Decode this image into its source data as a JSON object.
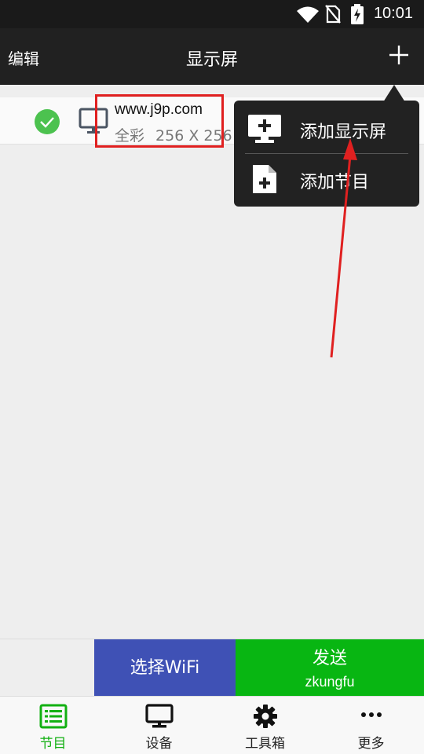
{
  "status_bar": {
    "time": "10:01",
    "icons": [
      "wifi-icon",
      "no-sim-icon",
      "battery-charging-icon"
    ]
  },
  "app_bar": {
    "edit_label": "编辑",
    "title": "显示屏",
    "add_icon": "plus-icon"
  },
  "screen_list": [
    {
      "name": "www.j9p.com",
      "color_mode": "全彩",
      "resolution": "256 X 256",
      "selected": true,
      "icons": [
        "check-circle-icon",
        "monitor-icon"
      ]
    }
  ],
  "popup_menu": {
    "items": [
      {
        "label": "添加显示屏",
        "icon": "add-display-icon"
      },
      {
        "label": "添加节目",
        "icon": "add-file-icon"
      }
    ]
  },
  "actions": {
    "wifi_label": "选择WiFi",
    "send_label": "发送",
    "send_sublabel": "zkungfu"
  },
  "bottom_nav": {
    "tabs": [
      {
        "label": "节目",
        "icon": "list-icon",
        "active": true
      },
      {
        "label": "设备",
        "icon": "monitor-icon",
        "active": false
      },
      {
        "label": "工具箱",
        "icon": "gear-icon",
        "active": false
      },
      {
        "label": "更多",
        "icon": "more-dots-icon",
        "active": false
      }
    ]
  },
  "colors": {
    "app_bar": "#212121",
    "active_green": "#12b012",
    "wifi_button": "#3f51b5",
    "send_button": "#08b612",
    "annotation_red": "#e02020"
  }
}
